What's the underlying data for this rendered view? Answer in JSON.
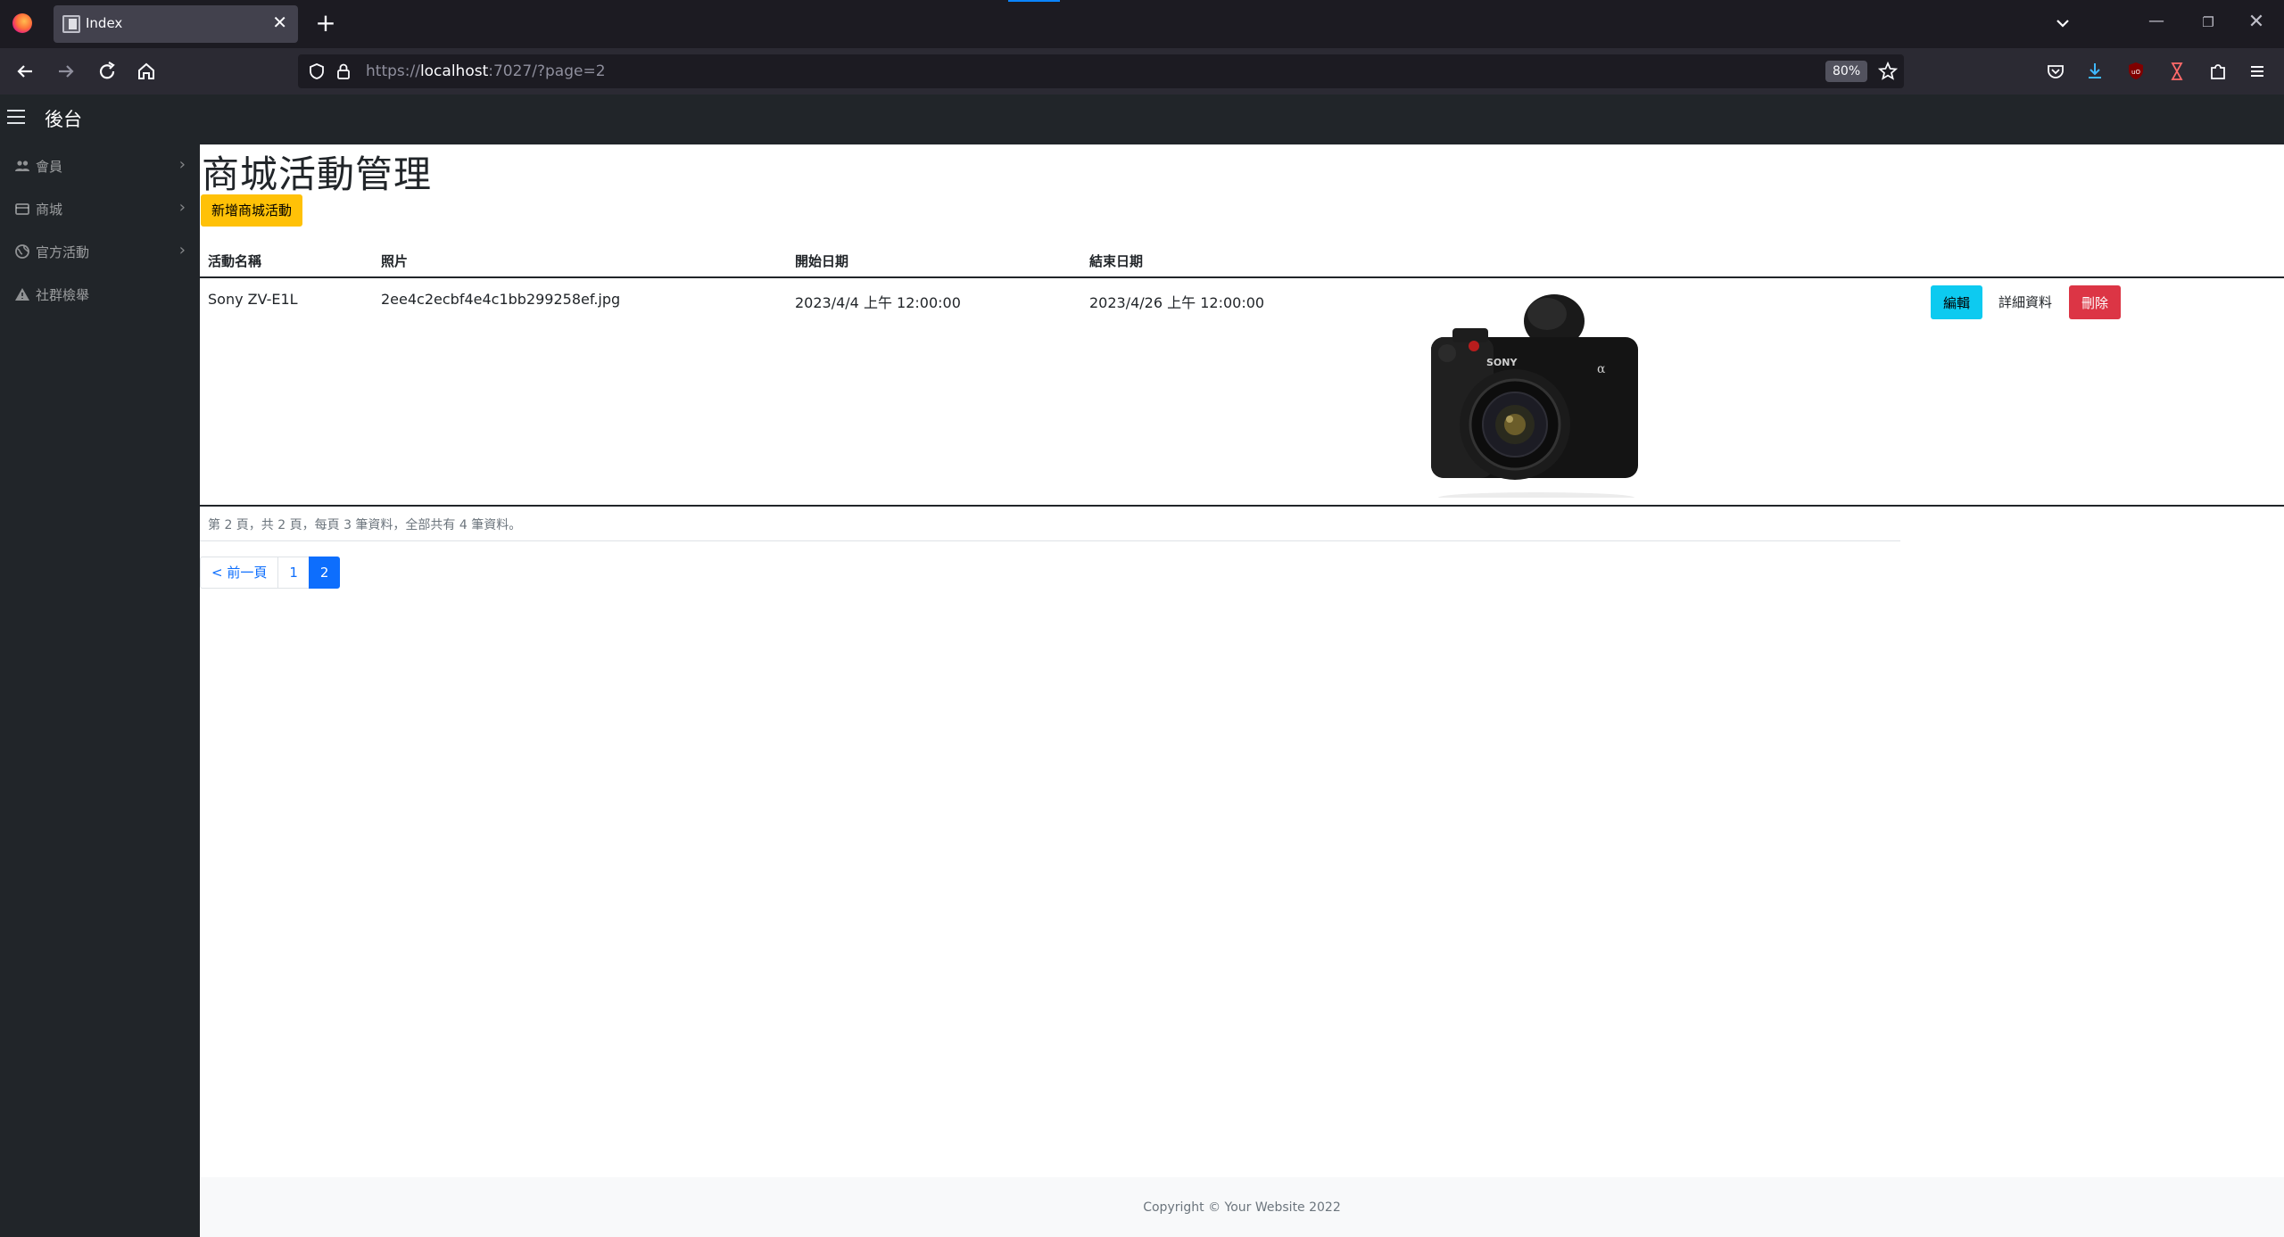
{
  "browser": {
    "tab_title": "Index",
    "url_prefix": "https://",
    "url_host": "localhost",
    "url_rest": ":7027/?page=2",
    "zoom": "80%",
    "accent_color": "#0a84ff"
  },
  "app": {
    "brand": "後台"
  },
  "sidebar": {
    "items": [
      {
        "label": "會員",
        "icon": "users-icon",
        "has_children": true
      },
      {
        "label": "商城",
        "icon": "store-icon",
        "has_children": true
      },
      {
        "label": "官方活動",
        "icon": "globe-icon",
        "has_children": true
      },
      {
        "label": "社群檢舉",
        "icon": "warning-icon",
        "has_children": false
      }
    ]
  },
  "main": {
    "title": "商城活動管理",
    "create_button": "新增商城活動",
    "columns": [
      "活動名稱",
      "照片",
      "開始日期",
      "結束日期"
    ],
    "rows": [
      {
        "name": "Sony ZV-E1L",
        "photo": "2ee4c2ecbf4e4c1bb299258ef.jpg",
        "start": "2023/4/4 上午 12:00:00",
        "end": "2023/4/26 上午 12:00:00",
        "edit_label": "編輯",
        "detail_label": "詳細資料",
        "delete_label": "刪除"
      }
    ],
    "pager_info": "第 2 頁，共 2 頁，每頁 3 筆資料，全部共有 4 筆資料。",
    "pagination": {
      "prev": "< 前一頁",
      "pages": [
        "1",
        "2"
      ],
      "current": "2"
    }
  },
  "footer": {
    "text": "Copyright © Your Website 2022"
  },
  "colors": {
    "create_button": "#ffc107",
    "edit_button": "#0dcaf0",
    "delete_button": "#dc3545",
    "active_page": "#0d6efd",
    "sidebar_bg": "#212529"
  }
}
